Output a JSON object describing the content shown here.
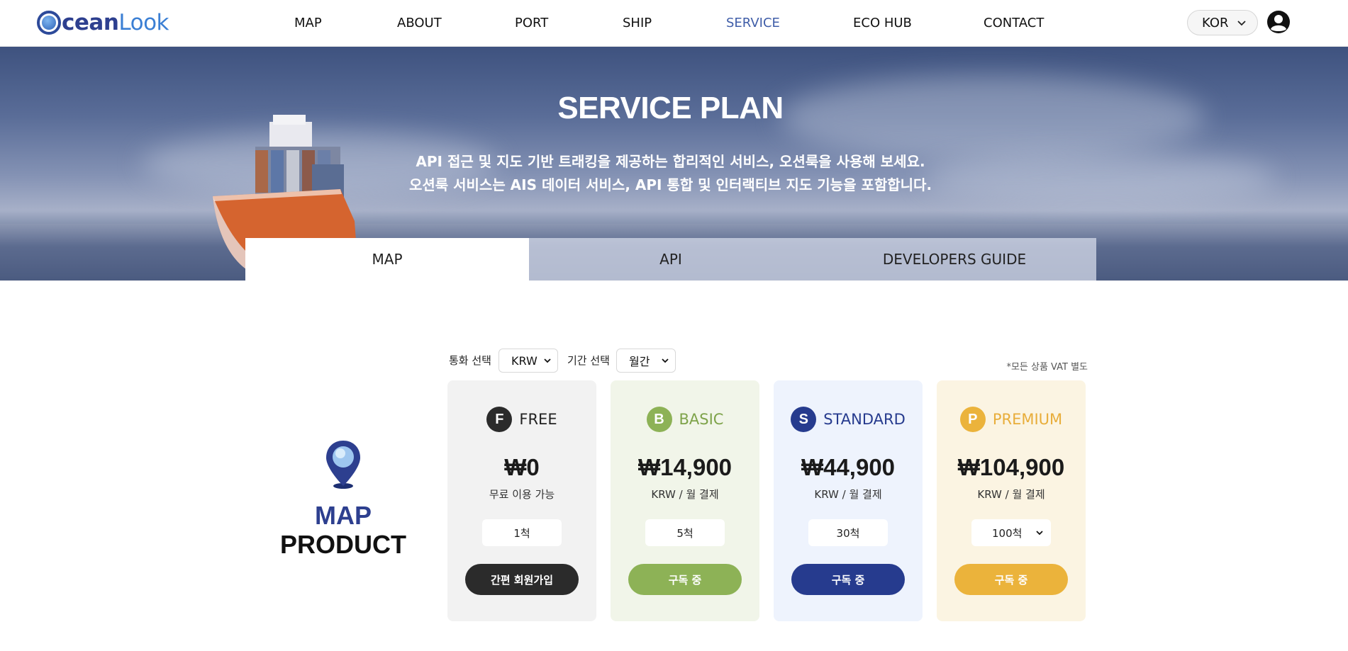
{
  "brand": {
    "logo_left": "cean",
    "logo_right": "Look"
  },
  "nav": {
    "items": [
      {
        "label": "MAP"
      },
      {
        "label": "ABOUT"
      },
      {
        "label": "PORT"
      },
      {
        "label": "SHIP"
      },
      {
        "label": "SERVICE",
        "active": true
      },
      {
        "label": "ECO HUB"
      },
      {
        "label": "CONTACT"
      }
    ],
    "language": "KOR"
  },
  "hero": {
    "title": "SERVICE PLAN",
    "line1": "API 접근 및 지도 기반 트래킹을 제공하는 합리적인 서비스, 오션룩을 사용해 보세요.",
    "line2": "오션룩 서비스는 AIS 데이터 서비스, API 통합 및 인터랙티브 지도 기능을 포함합니다."
  },
  "tabs": [
    {
      "label": "MAP",
      "active": true
    },
    {
      "label": "API"
    },
    {
      "label": "DEVELOPERS GUIDE"
    }
  ],
  "controls": {
    "currency_label": "통화 선택",
    "currency_value": "KRW",
    "period_label": "기간 선택",
    "period_value": "월간",
    "vat_note": "*모든 상품 VAT 별도"
  },
  "product": {
    "line1": "MAP",
    "line2": "PRODUCT"
  },
  "plans": [
    {
      "letter": "F",
      "name": "FREE",
      "price": "₩0",
      "period": "무료 이용 가능",
      "ships": "1척",
      "cta": "간편 회원가입",
      "color": "#2b2b2b",
      "name_color": "#222222",
      "bg": "#f2f2f2"
    },
    {
      "letter": "B",
      "name": "BASIC",
      "price": "₩14,900",
      "period": "KRW / 월 결제",
      "ships": "5척",
      "cta": "구독 중",
      "color": "#8db256",
      "name_color": "#7ea34a",
      "bg": "#f1f5e9"
    },
    {
      "letter": "S",
      "name": "STANDARD",
      "price": "₩44,900",
      "period": "KRW / 월 결제",
      "ships": "30척",
      "cta": "구독 중",
      "color": "#263b8e",
      "name_color": "#263b8e",
      "bg": "#eef3fd"
    },
    {
      "letter": "P",
      "name": "PREMIUM",
      "price": "₩104,900",
      "period": "KRW / 월 결제",
      "ships": "100척",
      "cta": "구독 중",
      "color": "#ebb33b",
      "name_color": "#e8ad3a",
      "bg": "#fbf4e2"
    }
  ]
}
